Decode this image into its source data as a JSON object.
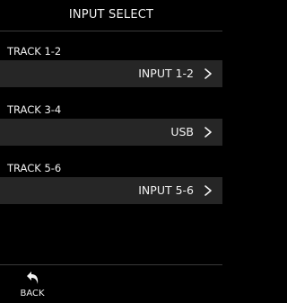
{
  "header": {
    "title": "INPUT SELECT"
  },
  "tracks": [
    {
      "label": "TRACK 1-2",
      "value": "INPUT 1-2"
    },
    {
      "label": "TRACK 3-4",
      "value": "USB"
    },
    {
      "label": "TRACK 5-6",
      "value": "INPUT 5-6"
    }
  ],
  "footer": {
    "back_label": "BACK",
    "back_icon": "back-arrow-icon"
  },
  "colors": {
    "background": "#000000",
    "row_background": "#262626",
    "text": "#f2f2f2",
    "rule": "#3a3a3a"
  }
}
